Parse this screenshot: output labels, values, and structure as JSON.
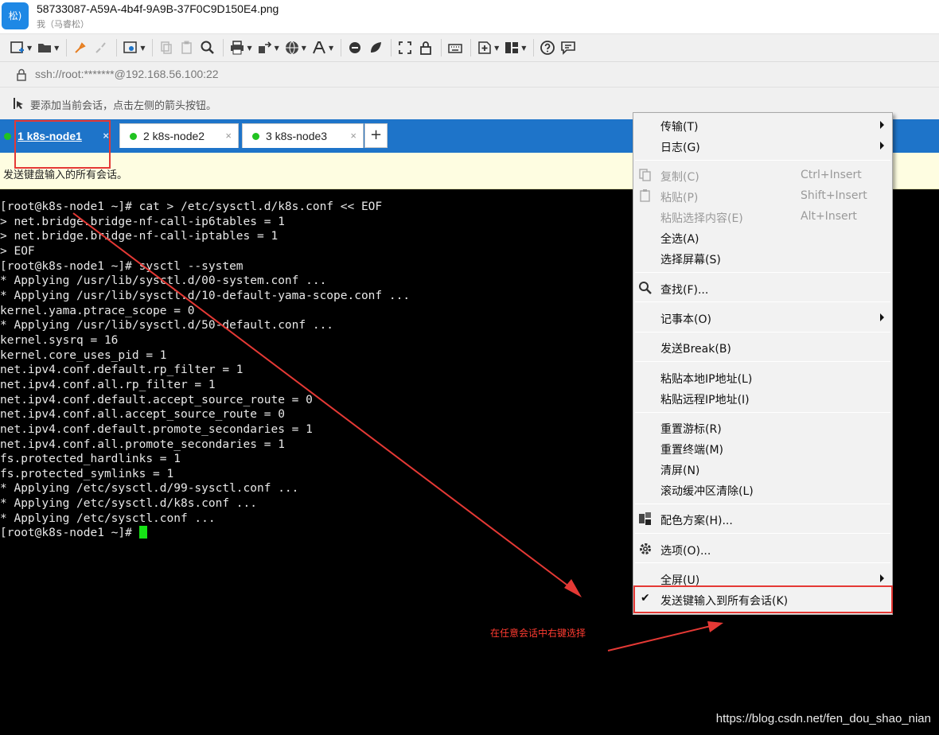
{
  "window": {
    "avatar_text": "松)",
    "file_title": "58733087-A59A-4b4f-9A9B-37F0C9D150E4.png",
    "file_sub": "我（马睿松）"
  },
  "address": "ssh://root:*******@192.168.56.100:22",
  "hint": "要添加当前会话，点击左侧的箭头按钮。",
  "tabs": [
    {
      "label": "1 k8s-node1",
      "close": "×"
    },
    {
      "label": "2 k8s-node2",
      "close": "×"
    },
    {
      "label": "3 k8s-node3",
      "close": "×"
    }
  ],
  "tab_add": "+",
  "banner": "发送键盘输入的所有会话。",
  "terminal": {
    "lines": [
      "[root@k8s-node1 ~]# cat > /etc/sysctl.d/k8s.conf << EOF",
      "> net.bridge.bridge-nf-call-ip6tables = 1",
      "> net.bridge.bridge-nf-call-iptables = 1",
      "> EOF",
      "[root@k8s-node1 ~]# sysctl --system",
      "* Applying /usr/lib/sysctl.d/00-system.conf ...",
      "* Applying /usr/lib/sysctl.d/10-default-yama-scope.conf ...",
      "kernel.yama.ptrace_scope = 0",
      "* Applying /usr/lib/sysctl.d/50-default.conf ...",
      "kernel.sysrq = 16",
      "kernel.core_uses_pid = 1",
      "net.ipv4.conf.default.rp_filter = 1",
      "net.ipv4.conf.all.rp_filter = 1",
      "net.ipv4.conf.default.accept_source_route = 0",
      "net.ipv4.conf.all.accept_source_route = 0",
      "net.ipv4.conf.default.promote_secondaries = 1",
      "net.ipv4.conf.all.promote_secondaries = 1",
      "fs.protected_hardlinks = 1",
      "fs.protected_symlinks = 1",
      "* Applying /etc/sysctl.d/99-sysctl.conf ...",
      "* Applying /etc/sysctl.d/k8s.conf ...",
      "* Applying /etc/sysctl.conf ..."
    ],
    "prompt": "[root@k8s-node1 ~]# "
  },
  "menu": {
    "transfer": "传输(T)",
    "log": "日志(G)",
    "copy": "复制(C)",
    "copy_accel": "Ctrl+Insert",
    "paste": "粘贴(P)",
    "paste_accel": "Shift+Insert",
    "paste_sel": "粘贴选择内容(E)",
    "paste_sel_accel": "Alt+Insert",
    "select_all": "全选(A)",
    "select_screen": "选择屏幕(S)",
    "find": "查找(F)...",
    "notepad": "记事本(O)",
    "send_break": "发送Break(B)",
    "paste_local_ip": "粘贴本地IP地址(L)",
    "paste_remote_ip": "粘贴远程IP地址(I)",
    "reset_cursor": "重置游标(R)",
    "reset_terminal": "重置终端(M)",
    "clear_screen": "清屏(N)",
    "clear_scrollback": "滚动缓冲区清除(L)",
    "color_scheme": "配色方案(H)...",
    "options": "选项(O)...",
    "fullscreen": "全屏(U)",
    "send_all": "发送键输入到所有会话(K)",
    "check": "✔"
  },
  "note": "在任意会话中右键选择",
  "watermark": "https://blog.csdn.net/fen_dou_shao_nian",
  "colors": {
    "accent": "#1e74c9",
    "annotation": "#e53935",
    "cursor": "#16e416"
  }
}
